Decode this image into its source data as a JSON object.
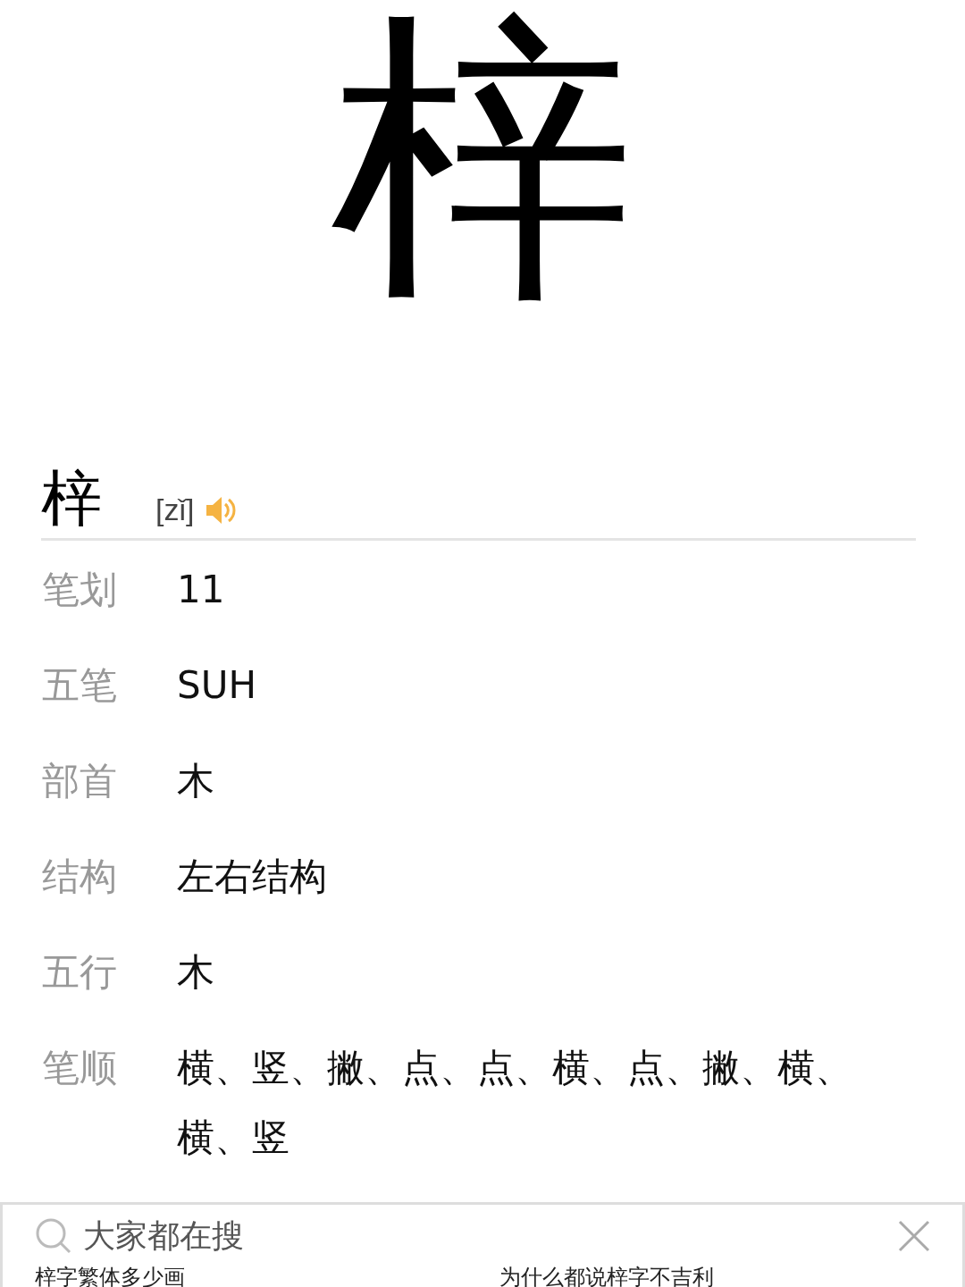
{
  "hero": {
    "character": "梓"
  },
  "header": {
    "character": "梓",
    "pinyin": "[zǐ]"
  },
  "details": [
    {
      "label": "笔划",
      "value": "11"
    },
    {
      "label": "五笔",
      "value": "SUH"
    },
    {
      "label": "部首",
      "value": "木"
    },
    {
      "label": "结构",
      "value": "左右结构"
    },
    {
      "label": "五行",
      "value": "木"
    },
    {
      "label": "笔顺",
      "value": "横、竖、撇、点、点、横、点、撇、横、横、竖"
    }
  ],
  "search_panel": {
    "title": "大家都在搜",
    "suggestions": [
      "梓字繁体多少画",
      "为什么都说梓字不吉利"
    ]
  }
}
